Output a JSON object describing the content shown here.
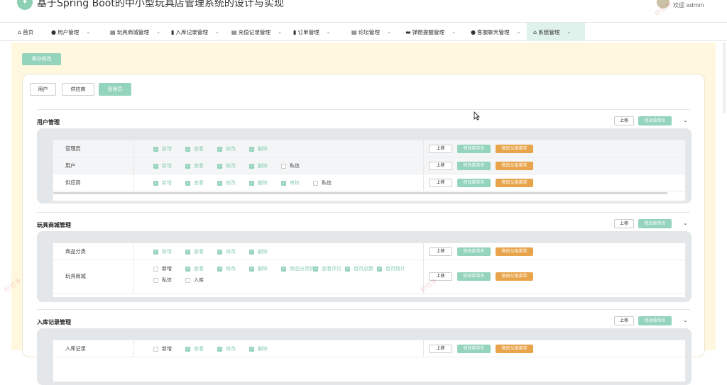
{
  "app": {
    "title": "基于Spring Boot的中小型玩具店管理系统的设计与实现",
    "user": "欢迎 admin"
  },
  "nav": [
    {
      "label": "首页",
      "icon": "⌂",
      "chevron": false
    },
    {
      "label": "用户管理",
      "icon": "●",
      "chevron": true
    },
    {
      "label": "玩具商城管理",
      "icon": "▤",
      "chevron": true
    },
    {
      "label": "入库记录管理",
      "icon": "▮",
      "chevron": true
    },
    {
      "label": "充值记录管理",
      "icon": "▤",
      "chevron": true
    },
    {
      "label": "订单管理",
      "icon": "▮",
      "chevron": true
    },
    {
      "label": "论坛管理",
      "icon": "▤",
      "chevron": true
    },
    {
      "label": "弹窗提醒管理",
      "icon": "▬",
      "chevron": true
    },
    {
      "label": "客服聊天管理",
      "icon": "●",
      "chevron": true
    },
    {
      "label": "系统管理",
      "icon": "⌂",
      "chevron": true,
      "active": true
    }
  ],
  "save_label": "保存修改",
  "role_tabs": [
    {
      "label": "用户",
      "active": false
    },
    {
      "label": "供应商",
      "active": false
    },
    {
      "label": "管理员",
      "active": true
    }
  ],
  "labels": {
    "up": "上移",
    "rename": "修改菜单名",
    "parent": "修改父级菜单"
  },
  "sections": [
    {
      "title": "用户管理",
      "rows": [
        {
          "name": "管理员",
          "perms": [
            {
              "label": "新增",
              "on": true
            },
            {
              "label": "查看",
              "on": true
            },
            {
              "label": "修改",
              "on": true
            },
            {
              "label": "删除",
              "on": true
            }
          ]
        },
        {
          "name": "用户",
          "perms": [
            {
              "label": "新增",
              "on": true
            },
            {
              "label": "查看",
              "on": true
            },
            {
              "label": "修改",
              "on": true
            },
            {
              "label": "删除",
              "on": true
            },
            {
              "label": "私信",
              "on": false
            }
          ]
        },
        {
          "name": "供应商",
          "perms": [
            {
              "label": "新增",
              "on": true
            },
            {
              "label": "查看",
              "on": true
            },
            {
              "label": "修改",
              "on": true
            },
            {
              "label": "删除",
              "on": true
            },
            {
              "label": "审核",
              "on": true
            },
            {
              "label": "私信",
              "on": false
            }
          ]
        }
      ]
    },
    {
      "title": "玩具商城管理",
      "rows": [
        {
          "name": "商品分类",
          "perms": [
            {
              "label": "新增",
              "on": true
            },
            {
              "label": "查看",
              "on": true
            },
            {
              "label": "修改",
              "on": true
            },
            {
              "label": "删除",
              "on": true
            }
          ]
        },
        {
          "name": "玩具商城",
          "perms": [
            {
              "label": "新增",
              "on": false
            },
            {
              "label": "查看",
              "on": true
            },
            {
              "label": "修改",
              "on": true
            },
            {
              "label": "删除",
              "on": true
            },
            {
              "label": "商品分类统计",
              "on": true
            },
            {
              "label": "查看评论",
              "on": true
            },
            {
              "label": "首页总数",
              "on": true
            },
            {
              "label": "首页统计",
              "on": true
            },
            {
              "label": "私信",
              "on": false
            },
            {
              "label": "入库",
              "on": false
            }
          ]
        }
      ]
    },
    {
      "title": "入库记录管理",
      "rows": [
        {
          "name": "入库记录",
          "perms": [
            {
              "label": "新增",
              "on": false
            },
            {
              "label": "查看",
              "on": true
            },
            {
              "label": "修改",
              "on": true
            },
            {
              "label": "删除",
              "on": true
            }
          ]
        }
      ]
    }
  ]
}
